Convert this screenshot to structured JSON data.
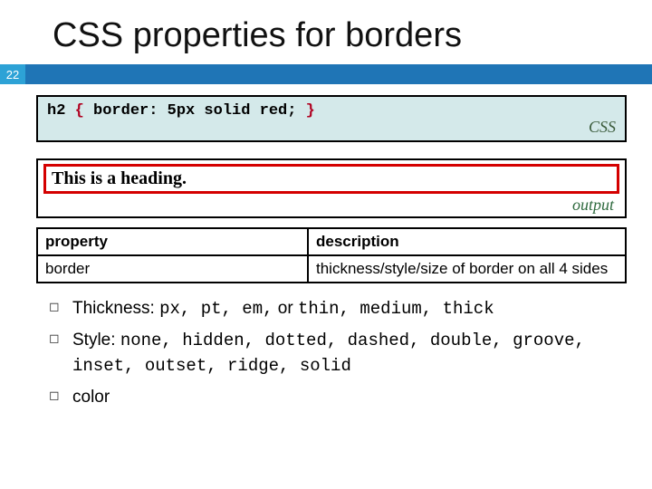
{
  "title": "CSS properties for borders",
  "pageNumber": "22",
  "code": {
    "selector": "h2",
    "open": "{",
    "decl": "border: 5px solid red;",
    "close": "}",
    "label": "CSS"
  },
  "output": {
    "heading": "This is a heading.",
    "label": "output"
  },
  "table": {
    "head": {
      "c1": "property",
      "c2": "description"
    },
    "rows": [
      {
        "c1": "border",
        "c2": "thickness/style/size of border on all 4 sides"
      }
    ]
  },
  "bullets": {
    "b1": {
      "label": "Thickness: ",
      "mono1": "px, pt, em,",
      "mid": " or ",
      "mono2": "thin, medium, thick"
    },
    "b2": {
      "label": "Style: ",
      "mono": "none, hidden, dotted, dashed, double, groove, inset, outset, ridge, solid"
    },
    "b3": {
      "label": "color"
    }
  }
}
